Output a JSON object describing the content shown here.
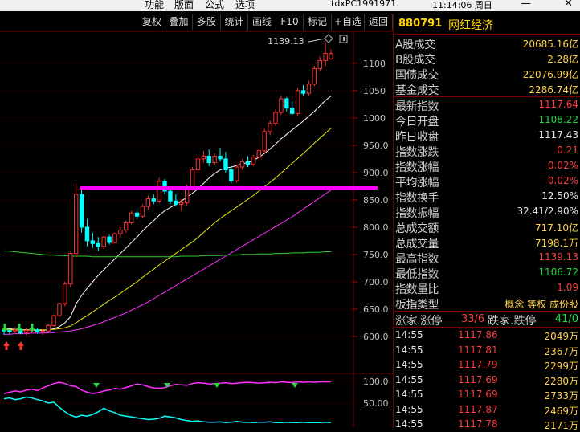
{
  "menubar": {
    "items": [
      "功能",
      "版面",
      "公式",
      "选项"
    ],
    "host": "tdxPC1991971",
    "clock": "11:14:06 周日",
    "minimize": "—",
    "close": "✕"
  },
  "toolbar": {
    "buttons": [
      "复权",
      "叠加",
      "多股",
      "统计",
      "画线",
      "F10",
      "标记",
      "+自选",
      "返回"
    ]
  },
  "chart": {
    "max_label": "1139.13",
    "price_axis": [
      "1100",
      "1050",
      "1000",
      "950.0",
      "900.0",
      "850.0",
      "800.0",
      "750.0",
      "700.0",
      "650.0",
      "600.0"
    ],
    "indicator_axis": [
      "100.0",
      "50.00"
    ],
    "colors": {
      "up": "#ff3030",
      "down": "#00ffff",
      "ma1": "#ffffff",
      "ma2": "#e8e810",
      "ma3": "#ff30ff",
      "ma4": "#30d030",
      "support": "#ff00ff",
      "grid": "#6b0000"
    }
  },
  "chart_data": {
    "type": "candlestick",
    "title": "",
    "ylim": [
      575,
      1160
    ],
    "ohlc": [
      [
        612,
        618,
        603,
        610
      ],
      [
        611,
        616,
        604,
        609
      ],
      [
        610,
        617,
        605,
        612
      ],
      [
        612,
        614,
        604,
        606
      ],
      [
        607,
        615,
        603,
        611
      ],
      [
        611,
        618,
        606,
        614
      ],
      [
        612,
        616,
        605,
        608
      ],
      [
        608,
        613,
        603,
        610
      ],
      [
        610,
        622,
        608,
        620
      ],
      [
        620,
        640,
        618,
        638
      ],
      [
        638,
        662,
        636,
        660
      ],
      [
        660,
        700,
        655,
        696
      ],
      [
        696,
        755,
        690,
        752
      ],
      [
        752,
        880,
        745,
        860
      ],
      [
        860,
        870,
        790,
        800
      ],
      [
        800,
        815,
        765,
        775
      ],
      [
        775,
        790,
        762,
        770
      ],
      [
        770,
        782,
        756,
        765
      ],
      [
        765,
        784,
        760,
        782
      ],
      [
        782,
        786,
        768,
        772
      ],
      [
        772,
        790,
        770,
        788
      ],
      [
        788,
        800,
        780,
        795
      ],
      [
        795,
        812,
        790,
        808
      ],
      [
        808,
        830,
        805,
        826
      ],
      [
        826,
        836,
        815,
        820
      ],
      [
        820,
        842,
        816,
        838
      ],
      [
        838,
        858,
        832,
        852
      ],
      [
        852,
        860,
        842,
        848
      ],
      [
        848,
        890,
        845,
        884
      ],
      [
        884,
        888,
        860,
        866
      ],
      [
        866,
        872,
        842,
        848
      ],
      [
        848,
        860,
        838,
        842
      ],
      [
        842,
        852,
        830,
        845
      ],
      [
        845,
        878,
        840,
        872
      ],
      [
        872,
        910,
        868,
        905
      ],
      [
        905,
        930,
        898,
        925
      ],
      [
        925,
        940,
        918,
        930
      ],
      [
        930,
        942,
        912,
        918
      ],
      [
        918,
        935,
        914,
        930
      ],
      [
        930,
        945,
        920,
        925
      ],
      [
        925,
        938,
        900,
        905
      ],
      [
        905,
        912,
        880,
        885
      ],
      [
        885,
        915,
        882,
        910
      ],
      [
        910,
        925,
        905,
        920
      ],
      [
        920,
        930,
        910,
        915
      ],
      [
        915,
        932,
        912,
        928
      ],
      [
        928,
        945,
        922,
        940
      ],
      [
        940,
        980,
        936,
        975
      ],
      [
        975,
        995,
        968,
        990
      ],
      [
        990,
        1015,
        985,
        1010
      ],
      [
        1010,
        1040,
        1005,
        1035
      ],
      [
        1035,
        1038,
        1012,
        1018
      ],
      [
        1018,
        1030,
        1005,
        1008
      ],
      [
        1008,
        1055,
        1004,
        1050
      ],
      [
        1050,
        1060,
        1040,
        1045
      ],
      [
        1045,
        1068,
        1040,
        1062
      ],
      [
        1062,
        1095,
        1058,
        1090
      ],
      [
        1090,
        1112,
        1085,
        1105
      ],
      [
        1105,
        1139.13,
        1095,
        1118
      ],
      [
        1108.22,
        1125,
        1106.72,
        1117.64
      ]
    ],
    "ma_series": [
      {
        "values": [
          615,
          614,
          613,
          612,
          612,
          612,
          611,
          611,
          612,
          614,
          618,
          625,
          636,
          660,
          675,
          688,
          700,
          712,
          722,
          732,
          742,
          752,
          762,
          772,
          782,
          793,
          803,
          812,
          822,
          830,
          836,
          842,
          848,
          855,
          862,
          870,
          880,
          890,
          898,
          905,
          908,
          910,
          913,
          916,
          918,
          922,
          928,
          935,
          943,
          952,
          962,
          970,
          978,
          986,
          994,
          1003,
          1012,
          1022,
          1032,
          1040
        ]
      },
      {
        "values": [
          612,
          612,
          612,
          612,
          612,
          612,
          612,
          612,
          612,
          613,
          614,
          616,
          619,
          625,
          632,
          638,
          645,
          652,
          659,
          666,
          672,
          679,
          686,
          693,
          700,
          708,
          716,
          723,
          731,
          738,
          745,
          752,
          759,
          766,
          773,
          781,
          790,
          799,
          808,
          816,
          823,
          830,
          837,
          844,
          851,
          858,
          866,
          874,
          882,
          890,
          899,
          908,
          917,
          926,
          935,
          944,
          954,
          963,
          972,
          981
        ]
      },
      {
        "values": [
          604,
          604,
          605,
          605,
          605,
          606,
          606,
          606,
          607,
          607,
          608,
          609,
          610,
          612,
          614,
          617,
          620,
          623,
          627,
          631,
          635,
          639,
          643,
          648,
          653,
          658,
          663,
          669,
          675,
          681,
          687,
          693,
          699,
          705,
          711,
          717,
          723,
          729,
          735,
          741,
          747,
          753,
          759,
          765,
          771,
          777,
          783,
          789,
          795,
          801,
          807,
          813,
          819,
          826,
          833,
          840,
          847,
          854,
          861,
          868
        ]
      },
      {
        "values": [
          757,
          756,
          755,
          754,
          753,
          752,
          751,
          750,
          749,
          749,
          748,
          748,
          747,
          747,
          747,
          747,
          746,
          746,
          746,
          746,
          746,
          746,
          746,
          746,
          746,
          746,
          746,
          746,
          746,
          746,
          746,
          746,
          747,
          747,
          747,
          747,
          748,
          748,
          748,
          748,
          749,
          749,
          749,
          750,
          750,
          750,
          751,
          751,
          751,
          752,
          752,
          752,
          753,
          753,
          753,
          754,
          754,
          754,
          755,
          755
        ]
      }
    ],
    "support_level": 872
  },
  "panel": {
    "code": "880791",
    "name": "网红经济",
    "stats": [
      {
        "k": "A股成交",
        "v": "20685.16亿",
        "c": "yel"
      },
      {
        "k": "B股成交",
        "v": "2.28亿",
        "c": "yel"
      },
      {
        "k": "国债成交",
        "v": "22076.99亿",
        "c": "yel"
      },
      {
        "k": "基金成交",
        "v": "2286.74亿",
        "c": "yel"
      },
      {
        "k": "最新指数",
        "v": "1117.64",
        "c": "red"
      },
      {
        "k": "今日开盘",
        "v": "1108.22",
        "c": "grn"
      },
      {
        "k": "昨日收盘",
        "v": "1117.43",
        "c": "wht"
      },
      {
        "k": "指数涨跌",
        "v": "0.21",
        "c": "red"
      },
      {
        "k": "指数涨幅",
        "v": "0.02%",
        "c": "red"
      },
      {
        "k": "平均涨幅",
        "v": "0.02%",
        "c": "red"
      },
      {
        "k": "指数换手",
        "v": "12.50%",
        "c": "wht"
      },
      {
        "k": "指数振幅",
        "v": "32.41/2.90%",
        "c": "wht"
      },
      {
        "k": "总成交额",
        "v": "717.10亿",
        "c": "yel"
      },
      {
        "k": "总成交量",
        "v": "7198.1万",
        "c": "yel"
      },
      {
        "k": "最高指数",
        "v": "1139.13",
        "c": "red"
      },
      {
        "k": "最低指数",
        "v": "1106.72",
        "c": "grn"
      },
      {
        "k": "指数量比",
        "v": "1.09",
        "c": "red"
      }
    ],
    "type_label": "板指类型",
    "type_value": "概念 等权 成份股",
    "updown_label": "涨家.涨停",
    "updown_value": "33/6",
    "fall_label": "跌家.跌停",
    "fall_value": "41/0",
    "ticks": [
      {
        "t": "14:55",
        "p": "1117.86",
        "v": "2049万"
      },
      {
        "t": "14:55",
        "p": "1117.81",
        "v": "2367万"
      },
      {
        "t": "14:55",
        "p": "1117.79",
        "v": "2299万"
      },
      {
        "t": "14:55",
        "p": "1117.69",
        "v": "2280万"
      },
      {
        "t": "14:55",
        "p": "1117.69",
        "v": "2733万"
      },
      {
        "t": "14:55",
        "p": "1117.87",
        "v": "2469万"
      },
      {
        "t": "14:55",
        "p": "1117.78",
        "v": "2171万"
      }
    ]
  }
}
